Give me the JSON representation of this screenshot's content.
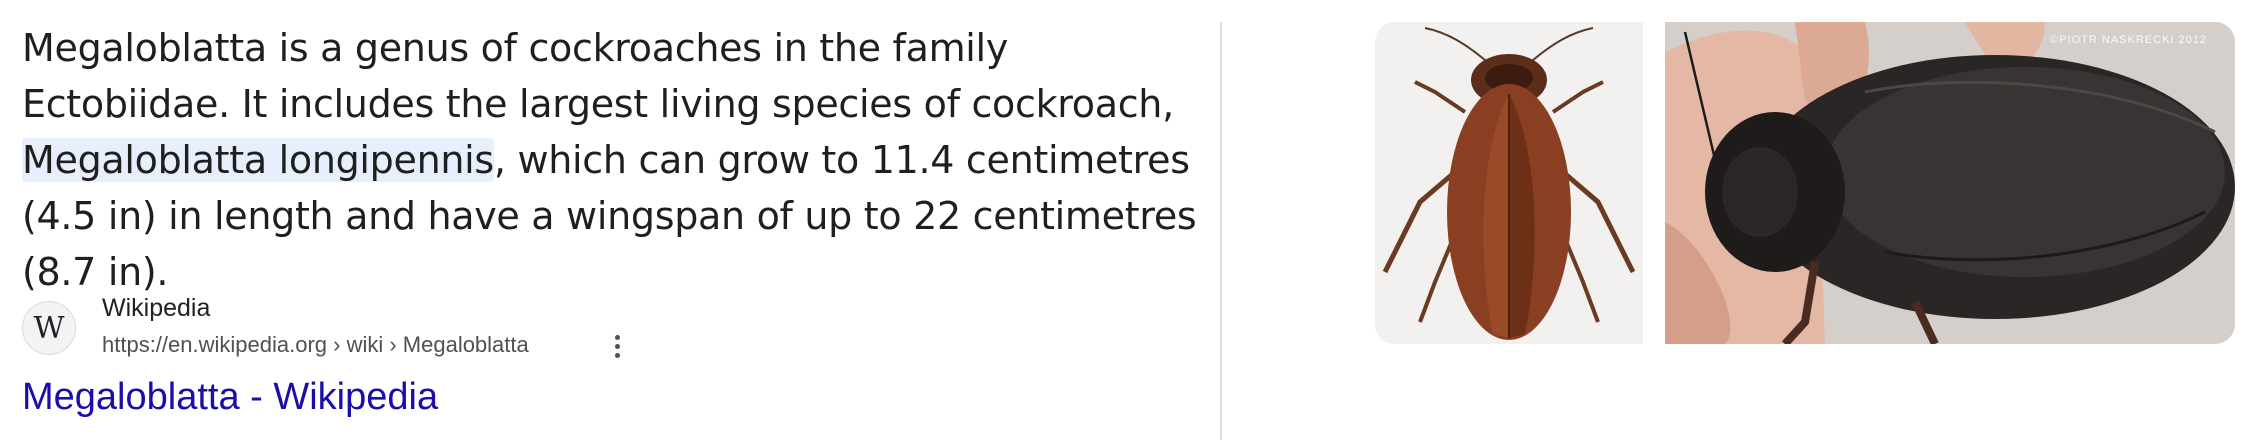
{
  "snippet": {
    "part1": "Megaloblatta is a genus of cockroaches in the family Ectobiidae. It includes the largest living species of cockroach, ",
    "highlight": "Megaloblatta longipennis",
    "part2": ", which can grow to 11.4 centimetres (4.5 in) in length and have a wingspan of up to 22 centimetres (8.7 in)."
  },
  "source": {
    "favicon_letter": "W",
    "site_name": "Wikipedia",
    "url": "https://en.wikipedia.org › wiki › Megaloblatta"
  },
  "result": {
    "title": "Megaloblatta - Wikipedia"
  },
  "images": [
    {
      "icon": "cockroach-illustration-image"
    },
    {
      "icon": "cockroach-in-hand-photo-image",
      "watermark": "©PIOTR NASKRECKI 2012"
    }
  ],
  "colors": {
    "link": "#1a0dab",
    "highlight_bg": "#e7eefc",
    "text": "#1f1f1f",
    "url_text": "#4d5156"
  }
}
